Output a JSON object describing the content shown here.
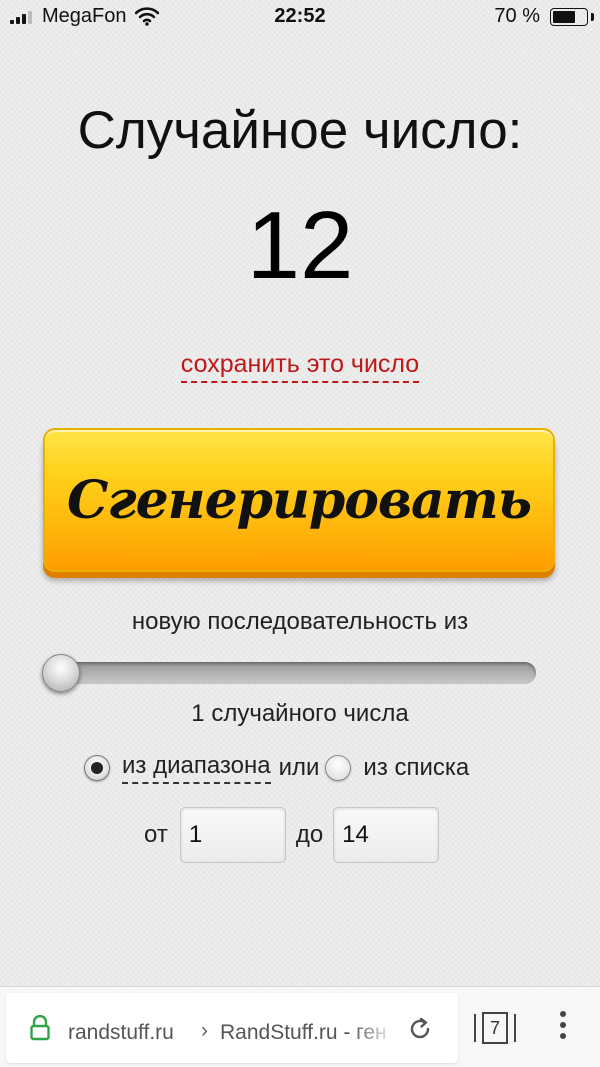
{
  "status_bar": {
    "carrier": "MegaFon",
    "time": "22:52",
    "battery_percent_text": "70 %",
    "battery_level": 0.7,
    "icons": [
      "signal-icon",
      "wifi-icon",
      "battery-icon"
    ]
  },
  "main": {
    "title": "Случайное число:",
    "number": "12",
    "save_link": "сохранить это число",
    "generate_button": "Сгенерировать",
    "button_colors": {
      "top": "#ffe54a",
      "bottom": "#ff9c00"
    },
    "sequence_label": "новую последовательность из",
    "slider_value": 1,
    "count_text": "1 случайного числа",
    "mode": {
      "range_label": "из диапазона",
      "or_label": "или",
      "list_label": "из списка",
      "selected": "range"
    },
    "range": {
      "from_label": "от",
      "from_value": "1",
      "to_label": "до",
      "to_value": "14"
    }
  },
  "browser": {
    "domain": "randstuff.ru",
    "separator": "›",
    "page_title": "RandStuff.ru - ген",
    "tab_count": "7",
    "lock_color": "#2fa34a",
    "icons": [
      "lock-icon",
      "reload-icon",
      "tabs-icon",
      "menu-icon"
    ]
  }
}
